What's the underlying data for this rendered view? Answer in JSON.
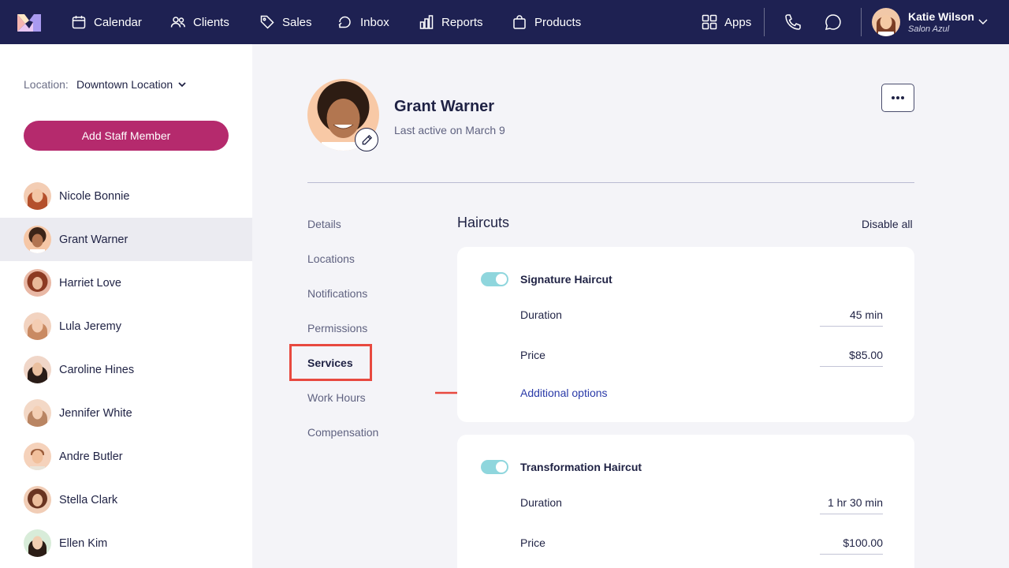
{
  "nav": {
    "items": [
      {
        "label": "Calendar",
        "icon": "calendar-icon"
      },
      {
        "label": "Clients",
        "icon": "users-icon"
      },
      {
        "label": "Sales",
        "icon": "tag-icon"
      },
      {
        "label": "Inbox",
        "icon": "inbox-icon"
      },
      {
        "label": "Reports",
        "icon": "bar-chart-icon"
      },
      {
        "label": "Products",
        "icon": "shopping-bag-icon"
      }
    ],
    "apps_label": "Apps",
    "user": {
      "name": "Katie Wilson",
      "org": "Salon Azul"
    },
    "colors": {
      "bar": "#1e2152",
      "accent": "#b52a6d"
    }
  },
  "sidebar": {
    "location_label": "Location:",
    "location_value": "Downtown Location",
    "add_button": "Add Staff Member",
    "staff": [
      {
        "name": "Nicole Bonnie"
      },
      {
        "name": "Grant Warner"
      },
      {
        "name": "Harriet Love"
      },
      {
        "name": "Lula Jeremy"
      },
      {
        "name": "Caroline Hines"
      },
      {
        "name": "Jennifer White"
      },
      {
        "name": "Andre Butler"
      },
      {
        "name": "Stella Clark"
      },
      {
        "name": "Ellen Kim"
      }
    ]
  },
  "profile": {
    "name": "Grant Warner",
    "last_active": "Last active on March 9"
  },
  "subnav": {
    "items": [
      "Details",
      "Locations",
      "Notifications",
      "Permissions",
      "Services",
      "Work Hours",
      "Compensation"
    ],
    "active": "Services"
  },
  "services": {
    "section_title": "Haircuts",
    "disable_all": "Disable all",
    "cards": [
      {
        "name": "Signature Haircut",
        "enabled": true,
        "duration_label": "Duration",
        "duration": "45 min",
        "price_label": "Price",
        "price": "$85.00",
        "options_link": "Additional options"
      },
      {
        "name": "Transformation Haircut",
        "enabled": true,
        "duration_label": "Duration",
        "duration": "1 hr 30 min",
        "price_label": "Price",
        "price": "$100.00"
      }
    ]
  }
}
